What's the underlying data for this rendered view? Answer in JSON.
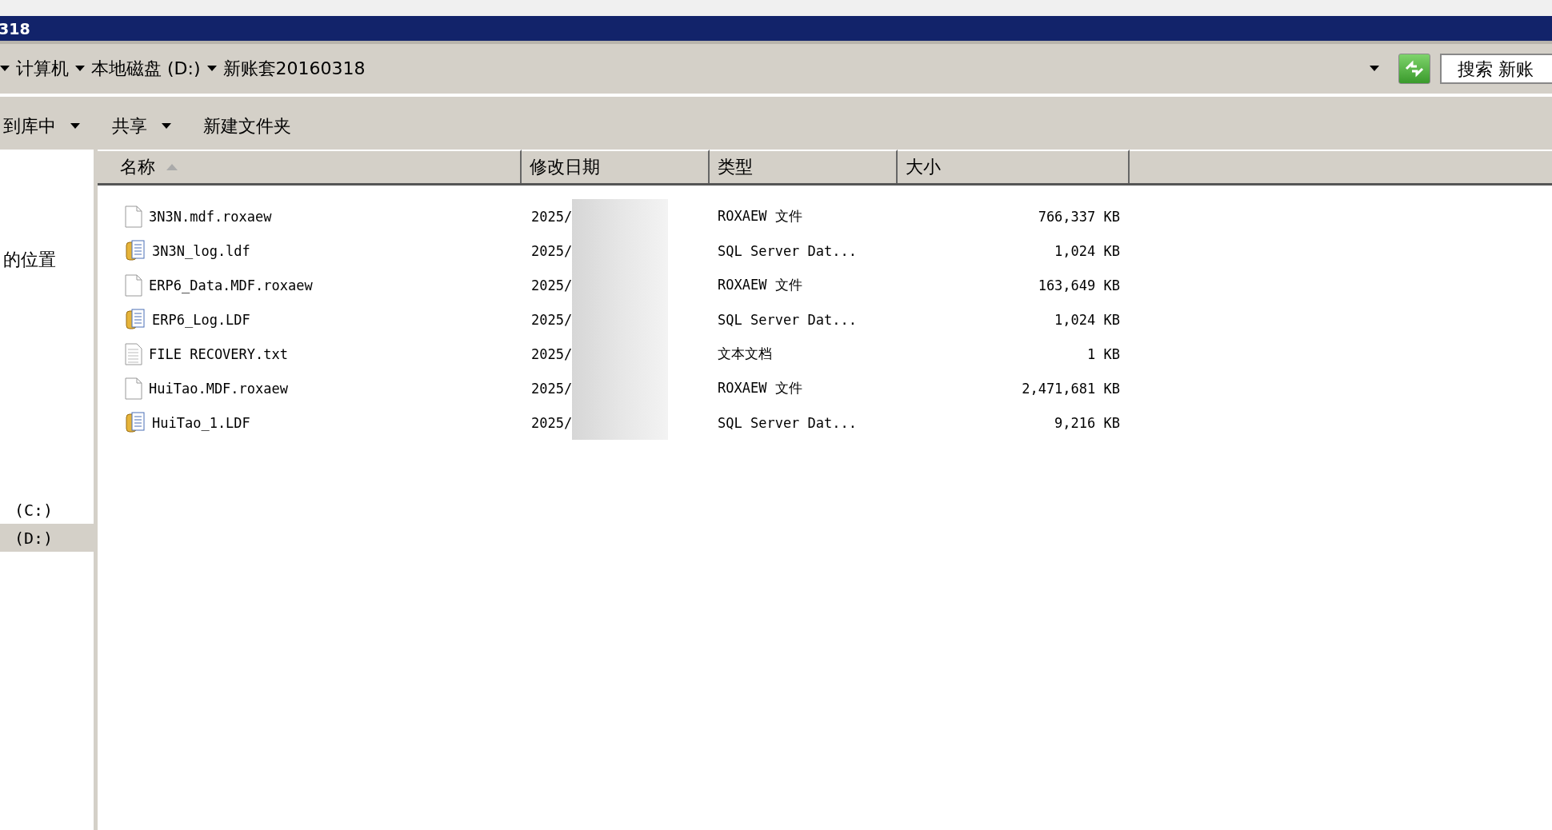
{
  "window": {
    "title": "318"
  },
  "address_bar": {
    "crumbs": [
      "计算机",
      "本地磁盘 (D:)",
      "新账套20160318"
    ],
    "search": {
      "placeholder": "搜索 新账"
    }
  },
  "toolbar": {
    "buttons": [
      {
        "label": "到库中",
        "dropdown": true
      },
      {
        "label": "共享",
        "dropdown": true
      },
      {
        "label": "新建文件夹",
        "dropdown": false
      }
    ]
  },
  "sidebar": {
    "items": [
      {
        "label": "的位置",
        "selected": false
      },
      {
        "label": "(C:)",
        "selected": false
      },
      {
        "label": "(D:)",
        "selected": true
      }
    ]
  },
  "table": {
    "columns": [
      {
        "label": "名称",
        "sorted": true
      },
      {
        "label": "修改日期",
        "sorted": false
      },
      {
        "label": "类型",
        "sorted": false
      },
      {
        "label": "大小",
        "sorted": false
      }
    ],
    "rows": [
      {
        "name": "3N3N.mdf.roxaew",
        "kind": "blank",
        "date": "2025/",
        "type": "ROXAEW 文件",
        "size": "766,337 KB"
      },
      {
        "name": "3N3N_log.ldf",
        "kind": "database",
        "date": "2025/",
        "type": "SQL Server Dat...",
        "size": "1,024 KB"
      },
      {
        "name": "ERP6_Data.MDF.roxaew",
        "kind": "blank",
        "date": "2025/",
        "type": "ROXAEW 文件",
        "size": "163,649 KB"
      },
      {
        "name": "ERP6_Log.LDF",
        "kind": "database",
        "date": "2025/",
        "type": "SQL Server Dat...",
        "size": "1,024 KB"
      },
      {
        "name": "FILE RECOVERY.txt",
        "kind": "text",
        "date": "2025/",
        "type": "文本文档",
        "size": "1 KB"
      },
      {
        "name": "HuiTao.MDF.roxaew",
        "kind": "blank",
        "date": "2025/",
        "type": "ROXAEW 文件",
        "size": "2,471,681 KB"
      },
      {
        "name": "HuiTao_1.LDF",
        "kind": "database",
        "date": "2025/",
        "type": "SQL Server Dat...",
        "size": "9,216 KB"
      }
    ]
  }
}
